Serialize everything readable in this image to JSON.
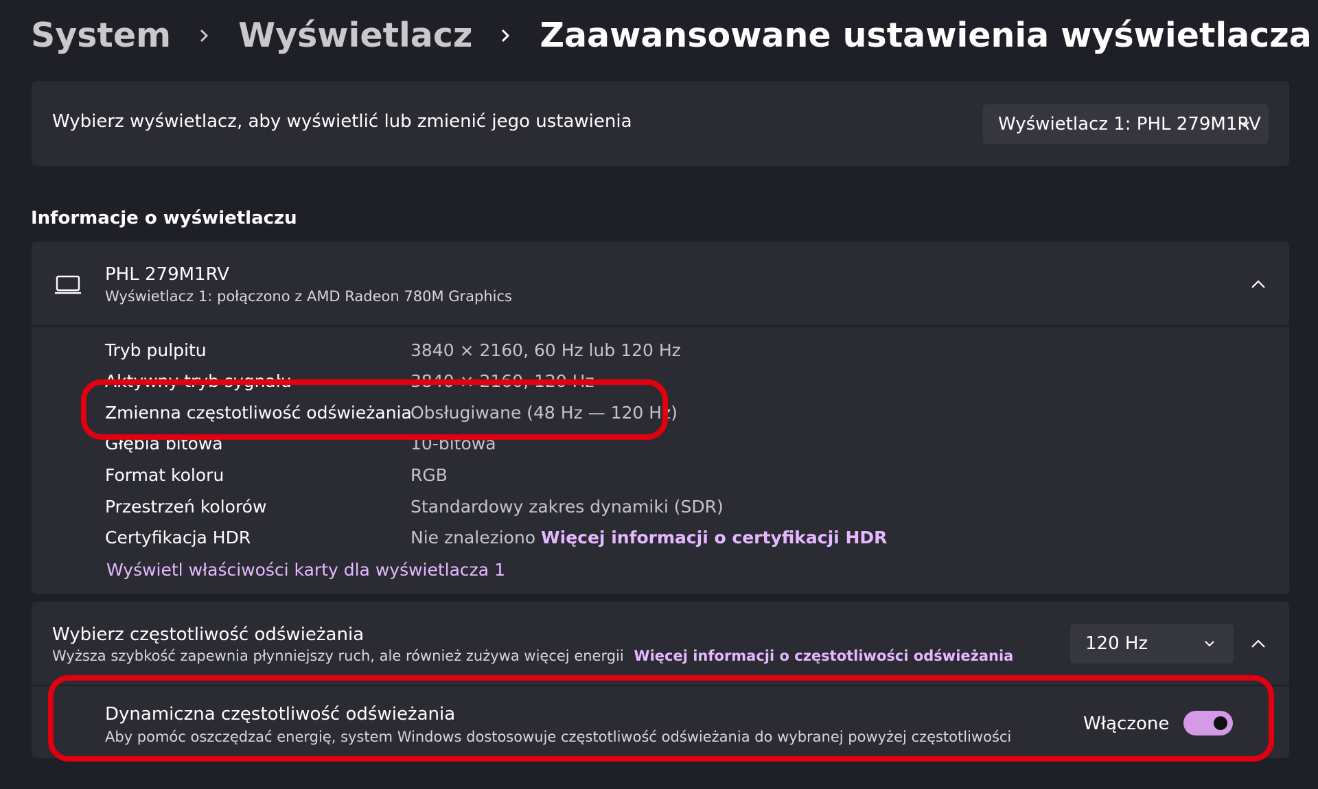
{
  "breadcrumb": {
    "items": [
      "System",
      "Wyświetlacz"
    ],
    "current": "Zaawansowane ustawienia wyświetlacza"
  },
  "display_select": {
    "label": "Wybierz wyświetlacz, aby wyświetlić lub zmienić jego ustawienia",
    "dropdown_value": "Wyświetlacz 1: PHL 279M1RV"
  },
  "info_section": {
    "title": "Informacje o wyświetlaczu",
    "monitor_name": "PHL 279M1RV",
    "monitor_subtitle": "Wyświetlacz 1: połączono z AMD Radeon 780M Graphics",
    "properties": [
      {
        "label": "Tryb pulpitu",
        "value": "3840 × 2160, 60 Hz lub 120 Hz"
      },
      {
        "label": "Aktywny tryb sygnału",
        "value": "3840 × 2160, 120 Hz"
      },
      {
        "label": "Zmienna częstotliwość odświeżania",
        "value": "Obsługiwane (48 Hz — 120 Hz)"
      },
      {
        "label": "Głębia bitowa",
        "value": "10-bitowa"
      },
      {
        "label": "Format koloru",
        "value": "RGB"
      },
      {
        "label": "Przestrzeń kolorów",
        "value": "Standardowy zakres dynamiki (SDR)"
      },
      {
        "label": "Certyfikacja HDR",
        "value": "Nie znaleziono",
        "link": "Więcej informacji o certyfikacji HDR"
      }
    ],
    "adapter_link": "Wyświetl właściwości karty dla wyświetlacza 1"
  },
  "refresh_section": {
    "title": "Wybierz częstotliwość odświeżania",
    "subtitle": "Wyższa szybkość zapewnia płynniejszy ruch, ale również zużywa więcej energii",
    "link": "Więcej informacji o częstotliwości odświeżania",
    "dropdown_value": "120 Hz",
    "dynamic": {
      "title": "Dynamiczna częstotliwość odświeżania",
      "subtitle": "Aby pomóc oszczędzać energię, system Windows dostosowuje częstotliwość odświeżania do wybranej powyżej częstotliwości",
      "toggle_label": "Włączone",
      "toggle_on": true
    }
  },
  "colors": {
    "background": "#1f1f28",
    "card": "#2b2b33",
    "accent": "#e6b8ff",
    "toggle": "#d49ae6",
    "highlight": "#e0000f"
  }
}
